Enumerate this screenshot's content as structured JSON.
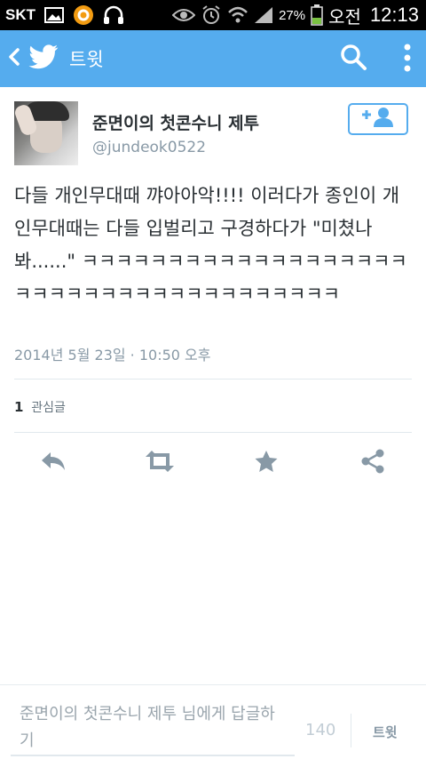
{
  "status_bar": {
    "carrier": "SKT",
    "battery_percent": "27%",
    "ampm": "오전",
    "time": "12:13",
    "icons": [
      "gallery-icon",
      "notification-circle-icon",
      "headphones-icon",
      "eye-icon",
      "alarm-icon",
      "wifi-icon",
      "signal-icon",
      "battery-icon"
    ]
  },
  "app_bar": {
    "title": "트윗",
    "background": "#55acee",
    "icons": [
      "back-icon",
      "twitter-bird-icon",
      "search-icon",
      "more-vert-icon"
    ]
  },
  "tweet": {
    "author_name": "준면이의 첫콘수니 제투",
    "author_handle": "@jundeok0522",
    "text": "다들 개인무대때 꺄아아악!!!! 이러다가 종인이 개인무대때는 다들 입벌리고 구경하다가 \"미쳤나봐......\" ㅋㅋㅋㅋㅋㅋㅋㅋㅋㅋㅋㅋㅋㅋㅋㅋㅋㅋㅋㅋㅋㅋㅋㅋㅋㅋㅋㅋㅋㅋㅋㅋㅋㅋㅋㅋㅋㅋ",
    "timestamp": "2014년 5월 23일 · 10:50 오후",
    "favorites_count": "1",
    "favorites_label": "관심글",
    "follow_icon": "add-user-icon"
  },
  "actions": [
    "reply-icon",
    "retweet-icon",
    "favorite-star-icon",
    "share-icon"
  ],
  "reply_bar": {
    "placeholder": "준면이의 첫콘수니 제투 님에게 답글하기",
    "char_count": "140",
    "send_label": "트윗"
  },
  "colors": {
    "accent": "#55acee",
    "muted_text": "#8899a6",
    "action_icon": "#8899a6"
  }
}
